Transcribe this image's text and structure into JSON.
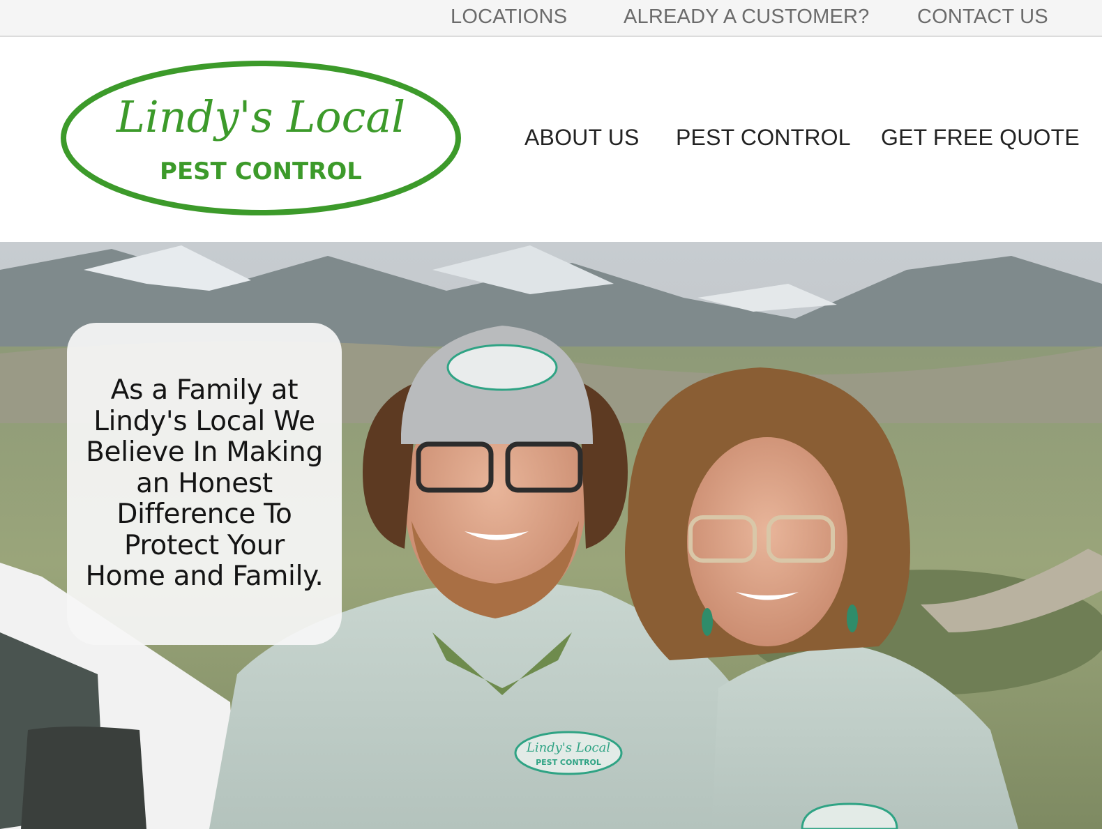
{
  "utility_nav": {
    "locations": "LOCATIONS",
    "already_customer": "ALREADY A CUSTOMER?",
    "contact_us": "CONTACT US"
  },
  "logo": {
    "script_text": "Lindy's Local",
    "block_text": "PEST CONTROL",
    "color": "#3c9a2a"
  },
  "main_nav": {
    "about_us": "ABOUT US",
    "pest_control": "PEST CONTROL",
    "get_free_quote": "GET FREE QUOTE"
  },
  "hero": {
    "tagline": "As a Family at Lindy's Local We Believe In Making an Honest Difference To Protect Your Home and Family.",
    "patch_script": "Lindy's Local",
    "patch_block": "PEST CONTROL",
    "patch_color": "#2fa384"
  },
  "colors": {
    "utility_bg": "#f5f5f5",
    "utility_text": "#6b6b6b",
    "nav_text": "#222222",
    "brand_green": "#3c9a2a"
  }
}
